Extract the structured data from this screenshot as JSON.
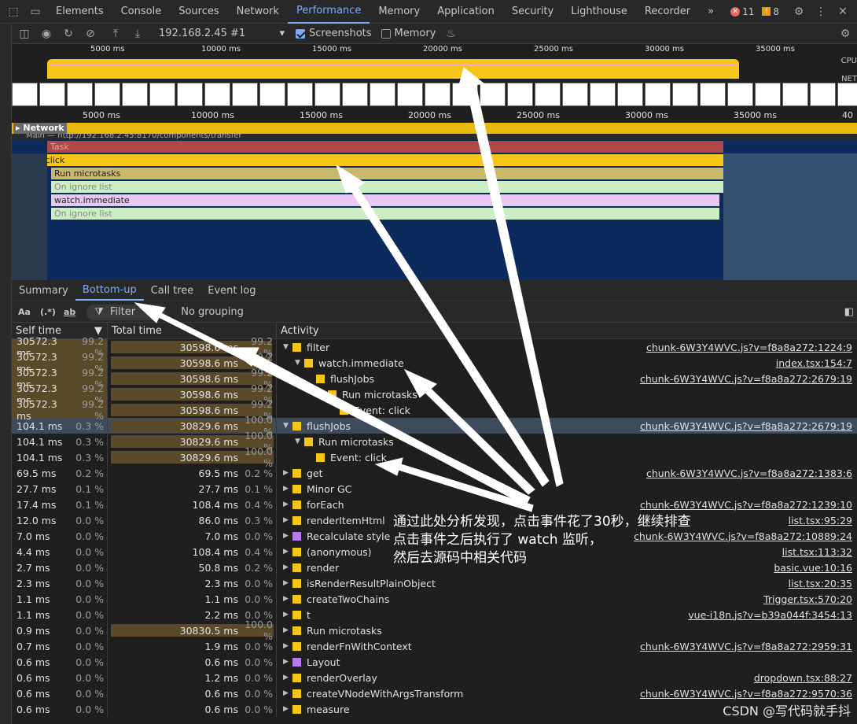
{
  "tabs": [
    "Elements",
    "Console",
    "Sources",
    "Network",
    "Performance",
    "Memory",
    "Application",
    "Security",
    "Lighthouse",
    "Recorder"
  ],
  "active_tab": "Performance",
  "more_tabs": "»",
  "errors_count": "11",
  "warnings_count": "8",
  "toolbar": {
    "target": "192.168.2.45 #1",
    "screenshots_label": "Screenshots",
    "memory_label": "Memory"
  },
  "overview": {
    "ruler_labels": [
      "5000 ms",
      "10000 ms",
      "15000 ms",
      "20000 ms",
      "25000 ms",
      "30000 ms",
      "35000 ms"
    ],
    "cpu_label": "CPU",
    "net_label": "NET"
  },
  "timeline_ruler": [
    "5000 ms",
    "10000 ms",
    "15000 ms",
    "20000 ms",
    "25000 ms",
    "30000 ms",
    "35000 ms",
    "40"
  ],
  "network_label": "Network",
  "main_label": "Main — http://192.168.2.45:8170/components/transfer",
  "flame": [
    {
      "label": "Task",
      "color": "#b0484a",
      "fg": "#e0a0a0"
    },
    {
      "label": "Event: click",
      "color": "#f5c518",
      "fg": "#202020"
    },
    {
      "label": "Run microtasks",
      "color": "#c9b96a",
      "fg": "#202020"
    },
    {
      "label": "On ignore list",
      "color": "#cdeec5",
      "fg": "#888888"
    },
    {
      "label": "watch.immediate",
      "color": "#e8c8f0",
      "fg": "#202020"
    },
    {
      "label": "On ignore list",
      "color": "#cdeec5",
      "fg": "#888888"
    }
  ],
  "bottom_tabs": [
    "Summary",
    "Bottom-up",
    "Call tree",
    "Event log"
  ],
  "bottom_active": "Bottom-up",
  "filter": {
    "case": "Aa",
    "regex": "(.*)",
    "word": "ab",
    "placeholder": "Filter",
    "grouping": "No grouping"
  },
  "columns": {
    "self": "Self time",
    "total": "Total time",
    "activity": "Activity"
  },
  "rows": [
    {
      "self": "30572.3 ms",
      "selfp": "99.2 %",
      "total": "30598.6 ms",
      "totalp": "99.2 %",
      "indent": 0,
      "arrow": "▼",
      "color": "#f5c518",
      "name": "filter",
      "link": "chunk-6W3Y4WVC.js?v=f8a8a272:1224:9",
      "bar": 99,
      "hl": true
    },
    {
      "self": "30572.3 ms",
      "selfp": "99.2 %",
      "total": "30598.6 ms",
      "totalp": "99.2 %",
      "indent": 1,
      "arrow": "▼",
      "color": "#f5c518",
      "name": "watch.immediate",
      "link": "index.tsx:154:7",
      "bar": 99,
      "hl": true
    },
    {
      "self": "30572.3 ms",
      "selfp": "99.2 %",
      "total": "30598.6 ms",
      "totalp": "99.2 %",
      "indent": 2,
      "arrow": "",
      "color": "#f5c518",
      "name": "flushJobs",
      "link": "chunk-6W3Y4WVC.js?v=f8a8a272:2679:19",
      "bar": 99,
      "hl": true
    },
    {
      "self": "30572.3 ms",
      "selfp": "99.2 %",
      "total": "30598.6 ms",
      "totalp": "99.2 %",
      "indent": 3,
      "arrow": "▼",
      "color": "#f5c518",
      "name": "Run microtasks",
      "link": "",
      "bar": 99,
      "hl": true
    },
    {
      "self": "30572.3 ms",
      "selfp": "99.2 %",
      "total": "30598.6 ms",
      "totalp": "99.2 %",
      "indent": 4,
      "arrow": "",
      "color": "#f5c518",
      "name": "Event: click",
      "link": "",
      "bar": 99,
      "hl": true
    },
    {
      "self": "104.1 ms",
      "selfp": "0.3 %",
      "total": "30829.6 ms",
      "totalp": "100.0 %",
      "indent": 0,
      "arrow": "▼",
      "color": "#f5c518",
      "name": "flushJobs",
      "link": "chunk-6W3Y4WVC.js?v=f8a8a272:2679:19",
      "bar": 100,
      "hl": false,
      "sel": true
    },
    {
      "self": "104.1 ms",
      "selfp": "0.3 %",
      "total": "30829.6 ms",
      "totalp": "100.0 %",
      "indent": 1,
      "arrow": "▼",
      "color": "#f5c518",
      "name": "Run microtasks",
      "link": "",
      "bar": 100,
      "hl": false
    },
    {
      "self": "104.1 ms",
      "selfp": "0.3 %",
      "total": "30829.6 ms",
      "totalp": "100.0 %",
      "indent": 2,
      "arrow": "",
      "color": "#f5c518",
      "name": "Event: click",
      "link": "",
      "bar": 100,
      "hl": false
    },
    {
      "self": "69.5 ms",
      "selfp": "0.2 %",
      "total": "69.5 ms",
      "totalp": "0.2 %",
      "indent": 0,
      "arrow": "▶",
      "color": "#f5c518",
      "name": "get",
      "link": "chunk-6W3Y4WVC.js?v=f8a8a272:1383:6",
      "bar": 0
    },
    {
      "self": "27.7 ms",
      "selfp": "0.1 %",
      "total": "27.7 ms",
      "totalp": "0.1 %",
      "indent": 0,
      "arrow": "▶",
      "color": "#f5c518",
      "name": "Minor GC",
      "link": "",
      "bar": 0
    },
    {
      "self": "17.4 ms",
      "selfp": "0.1 %",
      "total": "108.4 ms",
      "totalp": "0.4 %",
      "indent": 0,
      "arrow": "▶",
      "color": "#f5c518",
      "name": "forEach",
      "link": "chunk-6W3Y4WVC.js?v=f8a8a272:1239:10",
      "bar": 0
    },
    {
      "self": "12.0 ms",
      "selfp": "0.0 %",
      "total": "86.0 ms",
      "totalp": "0.3 %",
      "indent": 0,
      "arrow": "▶",
      "color": "#f5c518",
      "name": "renderItemHtml",
      "link": "list.tsx:95:29",
      "bar": 0
    },
    {
      "self": "7.0 ms",
      "selfp": "0.0 %",
      "total": "7.0 ms",
      "totalp": "0.0 %",
      "indent": 0,
      "arrow": "▶",
      "color": "#b57cf0",
      "name": "Recalculate style",
      "link": "chunk-6W3Y4WVC.js?v=f8a8a272:10889:24",
      "bar": 0
    },
    {
      "self": "4.4 ms",
      "selfp": "0.0 %",
      "total": "108.4 ms",
      "totalp": "0.4 %",
      "indent": 0,
      "arrow": "▶",
      "color": "#f5c518",
      "name": "(anonymous)",
      "link": "list.tsx:113:32",
      "bar": 0
    },
    {
      "self": "2.7 ms",
      "selfp": "0.0 %",
      "total": "50.8 ms",
      "totalp": "0.2 %",
      "indent": 0,
      "arrow": "▶",
      "color": "#f5c518",
      "name": "render",
      "link": "basic.vue:10:16",
      "bar": 0
    },
    {
      "self": "2.3 ms",
      "selfp": "0.0 %",
      "total": "2.3 ms",
      "totalp": "0.0 %",
      "indent": 0,
      "arrow": "▶",
      "color": "#f5c518",
      "name": "isRenderResultPlainObject",
      "link": "list.tsx:20:35",
      "bar": 0
    },
    {
      "self": "1.1 ms",
      "selfp": "0.0 %",
      "total": "1.1 ms",
      "totalp": "0.0 %",
      "indent": 0,
      "arrow": "▶",
      "color": "#f5c518",
      "name": "createTwoChains",
      "link": "Trigger.tsx:570:20",
      "bar": 0
    },
    {
      "self": "1.1 ms",
      "selfp": "0.0 %",
      "total": "2.2 ms",
      "totalp": "0.0 %",
      "indent": 0,
      "arrow": "▶",
      "color": "#f5c518",
      "name": "t",
      "link": "vue-i18n.js?v=b39a044f:3454:13",
      "bar": 0
    },
    {
      "self": "0.9 ms",
      "selfp": "0.0 %",
      "total": "30830.5 ms",
      "totalp": "100.0 %",
      "indent": 0,
      "arrow": "▶",
      "color": "#f5c518",
      "name": "Run microtasks",
      "link": "",
      "bar": 100
    },
    {
      "self": "0.7 ms",
      "selfp": "0.0 %",
      "total": "1.9 ms",
      "totalp": "0.0 %",
      "indent": 0,
      "arrow": "▶",
      "color": "#f5c518",
      "name": "renderFnWithContext",
      "link": "chunk-6W3Y4WVC.js?v=f8a8a272:2959:31",
      "bar": 0
    },
    {
      "self": "0.6 ms",
      "selfp": "0.0 %",
      "total": "0.6 ms",
      "totalp": "0.0 %",
      "indent": 0,
      "arrow": "▶",
      "color": "#b57cf0",
      "name": "Layout",
      "link": "",
      "bar": 0
    },
    {
      "self": "0.6 ms",
      "selfp": "0.0 %",
      "total": "1.2 ms",
      "totalp": "0.0 %",
      "indent": 0,
      "arrow": "▶",
      "color": "#f5c518",
      "name": "renderOverlay",
      "link": "dropdown.tsx:88:27",
      "bar": 0
    },
    {
      "self": "0.6 ms",
      "selfp": "0.0 %",
      "total": "0.6 ms",
      "totalp": "0.0 %",
      "indent": 0,
      "arrow": "▶",
      "color": "#f5c518",
      "name": "createVNodeWithArgsTransform",
      "link": "chunk-6W3Y4WVC.js?v=f8a8a272:9570:36",
      "bar": 0
    },
    {
      "self": "0.6 ms",
      "selfp": "0.0 %",
      "total": "0.6 ms",
      "totalp": "0.0 %",
      "indent": 0,
      "arrow": "▶",
      "color": "#f5c518",
      "name": "measure",
      "link": "",
      "bar": 0
    }
  ],
  "annotation": [
    "通过此处分析发现，点击事件花了30秒，继续排查",
    "点击事件之后执行了 watch 监听，",
    "然后去源码中相关代码"
  ],
  "watermark": "CSDN @写代码就手抖"
}
